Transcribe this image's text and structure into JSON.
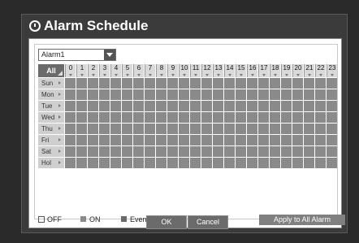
{
  "title": "Alarm Schedule",
  "alarm_select": {
    "value": "Alarm1"
  },
  "grid": {
    "corner_label": "All",
    "hours": [
      "0",
      "1",
      "2",
      "3",
      "4",
      "5",
      "6",
      "7",
      "8",
      "9",
      "10",
      "11",
      "12",
      "13",
      "14",
      "15",
      "16",
      "17",
      "18",
      "19",
      "20",
      "21",
      "22",
      "23"
    ],
    "days": [
      "Sun",
      "Mon",
      "Tue",
      "Wed",
      "Thu",
      "Fri",
      "Sat",
      "Hol"
    ]
  },
  "legend": {
    "off": {
      "label": "OFF",
      "color": "#ffffff"
    },
    "on": {
      "label": "ON",
      "color": "#8a8a8a"
    },
    "event_sync": {
      "label": "Event Sync",
      "color": "#6a6a6a"
    }
  },
  "buttons": {
    "apply_all": "Apply to All Alarm",
    "ok": "OK",
    "cancel": "Cancel"
  }
}
